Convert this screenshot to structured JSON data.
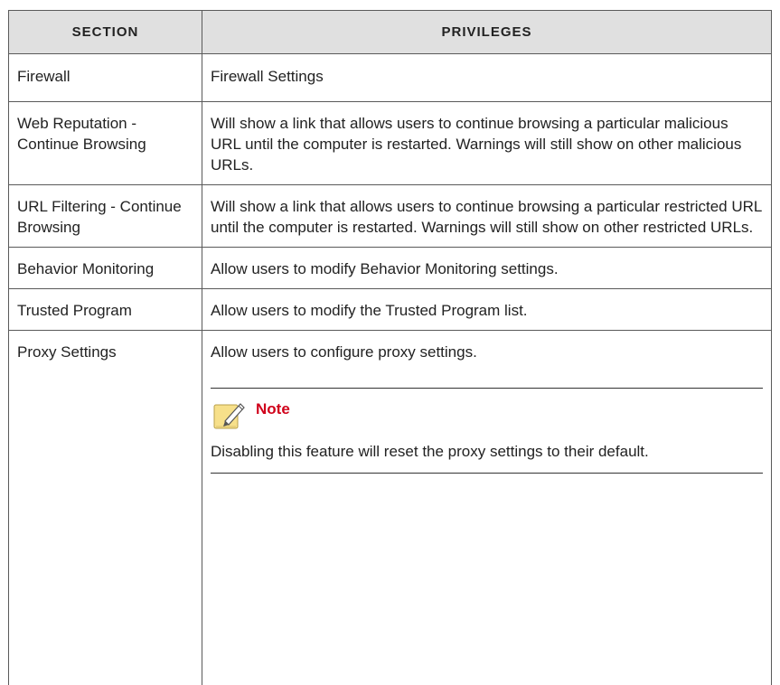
{
  "table": {
    "headers": {
      "section": "Section",
      "privileges": "Privileges"
    },
    "rows": [
      {
        "section": "Firewall",
        "privileges": "Firewall Settings"
      },
      {
        "section": "Web Reputation - Continue Browsing",
        "privileges": "Will show a link that allows users to continue browsing a particular malicious URL until the computer is restarted. Warnings will still show on other malicious URLs."
      },
      {
        "section": "URL Filtering - Continue Browsing",
        "privileges": "Will show a link that allows users to continue browsing a particular restricted URL until the computer is restarted. Warnings will still show on other restricted URLs."
      },
      {
        "section": "Behavior Monitoring",
        "privileges": "Allow users to modify Behavior Monitoring settings."
      },
      {
        "section": "Trusted Program",
        "privileges": "Allow users to modify the Trusted Program list."
      },
      {
        "section": "Proxy Settings",
        "privileges": "Allow users to configure proxy settings."
      }
    ],
    "note": {
      "title": "Note",
      "text": "Disabling this feature will reset the proxy settings to their default.",
      "icon": "note-pencil-icon"
    }
  },
  "colors": {
    "header_bg": "#e0e0e0",
    "border": "#5a5a5a",
    "note_title": "#d0021b",
    "icon_fill": "#f7e08a"
  }
}
